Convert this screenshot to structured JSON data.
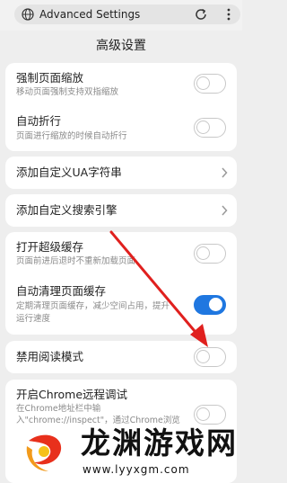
{
  "browser": {
    "url_text": "Advanced Settings"
  },
  "page": {
    "title": "高级设置"
  },
  "settings": {
    "force_zoom": {
      "label": "强制页面缩放",
      "sub": "移动页面强制支持双指缩放",
      "enabled": false
    },
    "auto_wrap": {
      "label": "自动折行",
      "sub": "页面进行缩放的时候自动折行",
      "enabled": false
    },
    "custom_ua": {
      "label": "添加自定义UA字符串"
    },
    "custom_engine": {
      "label": "添加自定义搜索引擎"
    },
    "super_cache": {
      "label": "打开超级缓存",
      "sub": "页面前进后退时不重新加载页面",
      "enabled": false
    },
    "auto_clear_cache": {
      "label": "自动清理页面缓存",
      "sub_line1": "定期清理页面缓存，减少空间占用，提升",
      "sub_line2": "运行速度",
      "enabled": true
    },
    "disable_reader": {
      "label": "禁用阅读模式",
      "enabled": false
    },
    "remote_debug": {
      "label": "开启Chrome远程调试",
      "sub_line1": "在Chrome地址栏中输",
      "sub_line2": "入\"chrome://inspect\"，通过Chrome浏览",
      "enabled": false
    }
  },
  "watermark": {
    "title": "龙渊游戏网",
    "url": "www.lyyxgm.com"
  },
  "colors": {
    "toggle_on": "#1f77e0",
    "arrow": "#e0201e"
  }
}
